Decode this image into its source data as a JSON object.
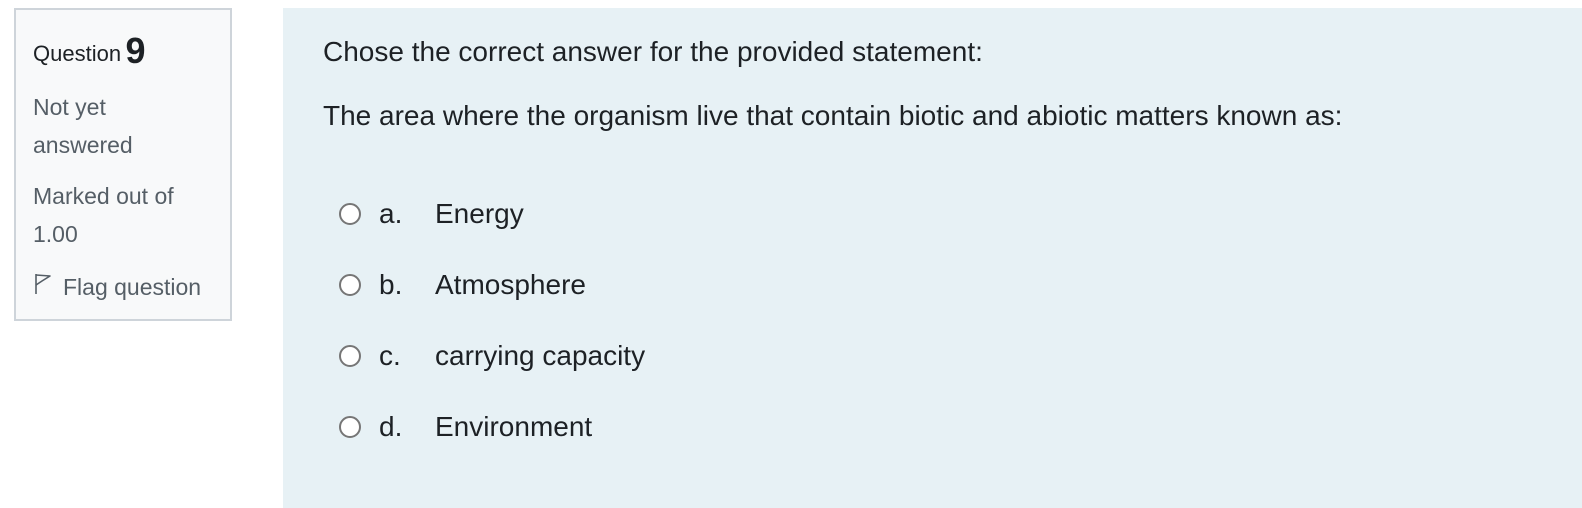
{
  "info": {
    "question_label": "Question",
    "question_number": "9",
    "state_line1": "Not yet",
    "state_line2": "answered",
    "grade_line1": "Marked out of",
    "grade_line2": "1.00",
    "flag_label": "Flag question",
    "flag_icon": "flag-outline-icon"
  },
  "question": {
    "intro": "Chose the correct answer for the provided statement:",
    "statement": "The area where the organism live that contain biotic and abiotic matters known as:",
    "answers": [
      {
        "letter": "a.",
        "text": "Energy",
        "selected": false
      },
      {
        "letter": "b.",
        "text": "Atmosphere",
        "selected": false
      },
      {
        "letter": "c.",
        "text": "carrying capacity",
        "selected": false
      },
      {
        "letter": "d.",
        "text": "Environment",
        "selected": false
      }
    ]
  },
  "colors": {
    "info_background": "#f8f9fa",
    "info_border": "#ced4da",
    "content_background": "#e7f1f5",
    "text_primary": "#1d2125",
    "text_muted": "#555e66"
  }
}
